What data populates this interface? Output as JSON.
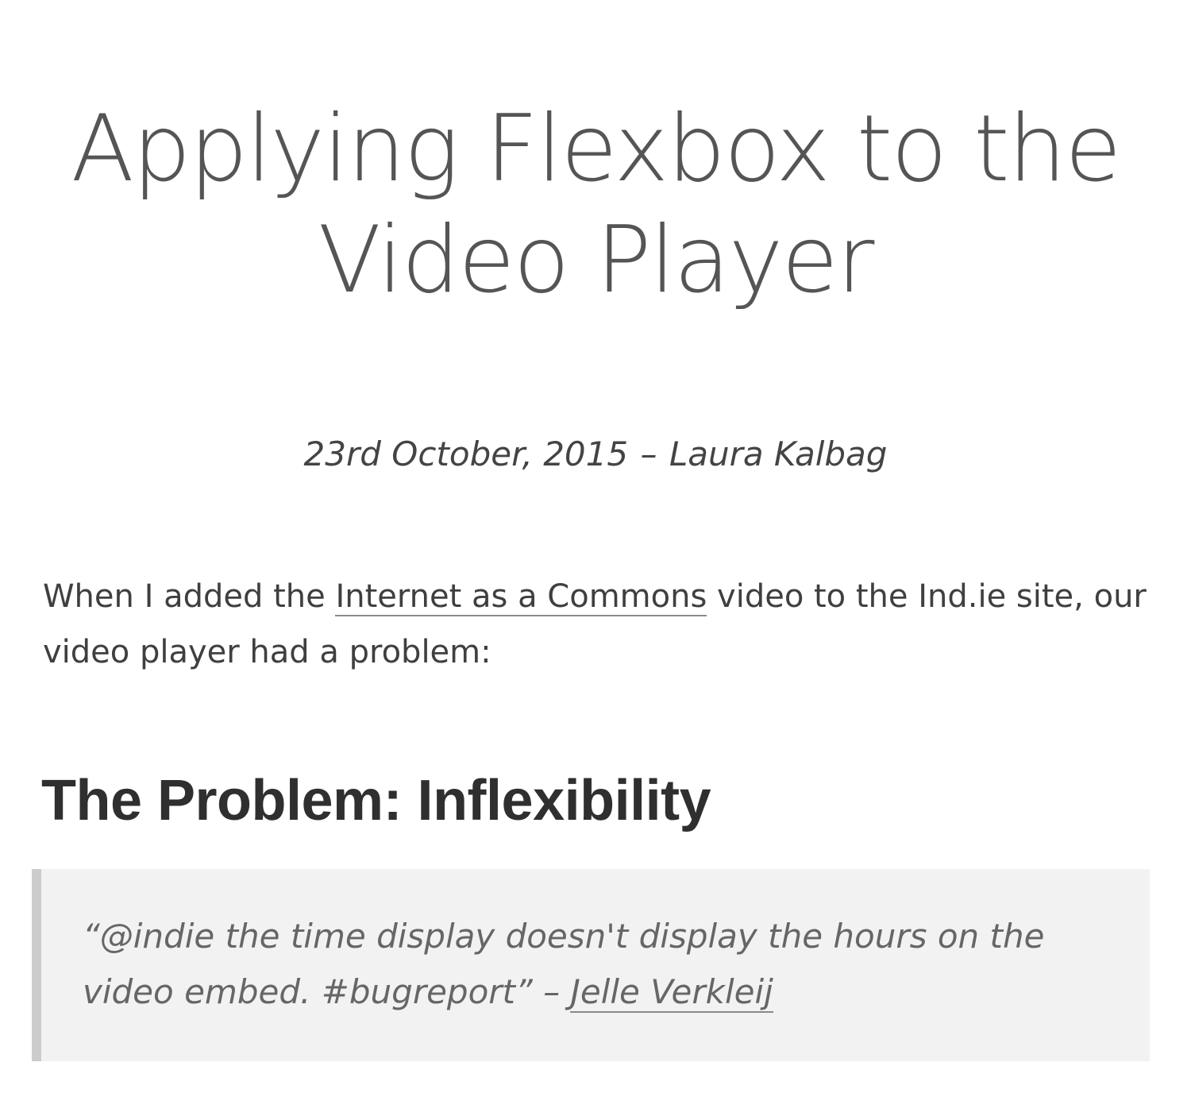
{
  "article": {
    "title": "Applying Flexbox to the Video Player",
    "byline": {
      "date": "23rd October, 2015",
      "dash": "–",
      "author": "Laura Kalbag"
    },
    "intro": {
      "before_link": "When I added the ",
      "link_text": "Internet as a Commons",
      "after_link": " video to the Ind.ie site, our video player had a problem:"
    },
    "section_heading": "The Problem: Inflexibility",
    "quote": {
      "text": "“@indie the time display doesn't display the hours on the video embed. #bugreport”",
      "dash": " – ",
      "author_link": "Jelle Verkleij"
    }
  }
}
